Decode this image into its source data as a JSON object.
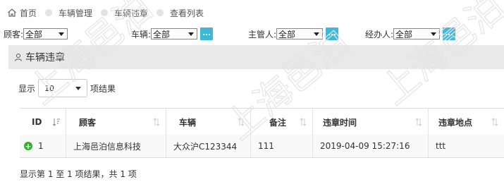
{
  "breadcrumb": {
    "items": [
      "首页",
      "车辆管理",
      "车辆违章",
      "查看列表"
    ]
  },
  "filters": {
    "customer": {
      "label": "顾客:",
      "value": "全部"
    },
    "vehicle": {
      "label": "车辆:",
      "value": "全部",
      "button": "..."
    },
    "manager": {
      "label": "主管人:",
      "value": "全部",
      "button": "..."
    },
    "handler": {
      "label": "经办人:",
      "value": "全部",
      "button": "..."
    }
  },
  "panel": {
    "title": "车辆违章"
  },
  "length": {
    "prefix": "显示",
    "value": "10",
    "suffix": "项结果"
  },
  "table": {
    "columns": [
      "ID",
      "顾客",
      "车辆",
      "备注",
      "违章时间",
      "违章地点"
    ],
    "rows": [
      {
        "id": "1",
        "customer": "上海邑泊信息科技",
        "vehicle": "大众沪C123344",
        "remark": "111",
        "time": "2019-04-09 15:27:16",
        "place": "ttt"
      }
    ]
  },
  "info": "显示第 1 至 1 项结果，共 1 项",
  "watermark": "上海邑泊",
  "colors": {
    "accent": "#3fb8d7",
    "expand": "#31b131",
    "panel": "#e9e9e9"
  }
}
